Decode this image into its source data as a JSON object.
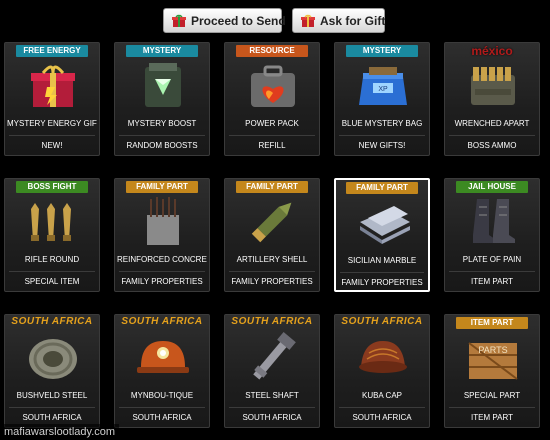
{
  "toolbar": {
    "send_label": "Proceed to Send",
    "ask_label": "Ask for Gift"
  },
  "items": [
    {
      "tag": "FREE ENERGY",
      "tag_style": "teal",
      "name": "MYSTERY ENERGY GIFT",
      "sub": "NEW!",
      "icon": "gift-box-icon"
    },
    {
      "tag": "MYSTERY",
      "tag_style": "teal",
      "name": "MYSTERY BOOST",
      "sub": "RANDOM BOOSTS",
      "icon": "mystery-boost-icon"
    },
    {
      "tag": "RESOURCE",
      "tag_style": "orange",
      "name": "POWER PACK",
      "sub": "REFILL",
      "icon": "power-pack-icon"
    },
    {
      "tag": "MYSTERY",
      "tag_style": "teal",
      "name": "BLUE MYSTERY BAG",
      "sub": "NEW GIFTS!",
      "icon": "mystery-bag-icon"
    },
    {
      "tag": "méxico",
      "tag_style": "mexico",
      "name": "WRENCHED APART",
      "sub": "BOSS AMMO",
      "icon": "ammo-box-icon"
    },
    {
      "tag": "BOSS FIGHT",
      "tag_style": "green",
      "name": "RIFLE ROUND",
      "sub": "SPECIAL ITEM",
      "icon": "rifle-round-icon"
    },
    {
      "tag": "FAMILY PART",
      "tag_style": "gold",
      "name": "REINFORCED CONCRETE",
      "sub": "FAMILY PROPERTIES",
      "icon": "concrete-block-icon"
    },
    {
      "tag": "FAMILY PART",
      "tag_style": "gold",
      "name": "ARTILLERY SHELL",
      "sub": "FAMILY PROPERTIES",
      "icon": "artillery-shell-icon"
    },
    {
      "tag": "FAMILY PART",
      "tag_style": "gold",
      "name": "SICILIAN MARBLE",
      "sub": "FAMILY PROPERTIES",
      "icon": "marble-slab-icon",
      "selected": true
    },
    {
      "tag": "JAIL HOUSE",
      "tag_style": "green",
      "name": "PLATE OF PAIN",
      "sub": "ITEM PART",
      "icon": "boots-icon"
    },
    {
      "tag": "SOUTH AFRICA",
      "tag_style": "safrica",
      "name": "BUSHVELD STEEL",
      "sub": "SOUTH AFRICA",
      "icon": "steel-coil-icon"
    },
    {
      "tag": "SOUTH AFRICA",
      "tag_style": "safrica",
      "name": "MYNBOU-TIQUE",
      "sub": "SOUTH AFRICA",
      "icon": "miner-helmet-icon"
    },
    {
      "tag": "SOUTH AFRICA",
      "tag_style": "safrica",
      "name": "STEEL SHAFT",
      "sub": "SOUTH AFRICA",
      "icon": "steel-shaft-icon"
    },
    {
      "tag": "SOUTH AFRICA",
      "tag_style": "safrica",
      "name": "KUBA CAP",
      "sub": "SOUTH AFRICA",
      "icon": "kuba-cap-icon"
    },
    {
      "tag": "ITEM PART",
      "tag_style": "gold",
      "name": "SPECIAL PART",
      "sub": "ITEM PART",
      "icon": "parts-crate-icon"
    }
  ],
  "watermark": "mafiawarslootlady.com"
}
